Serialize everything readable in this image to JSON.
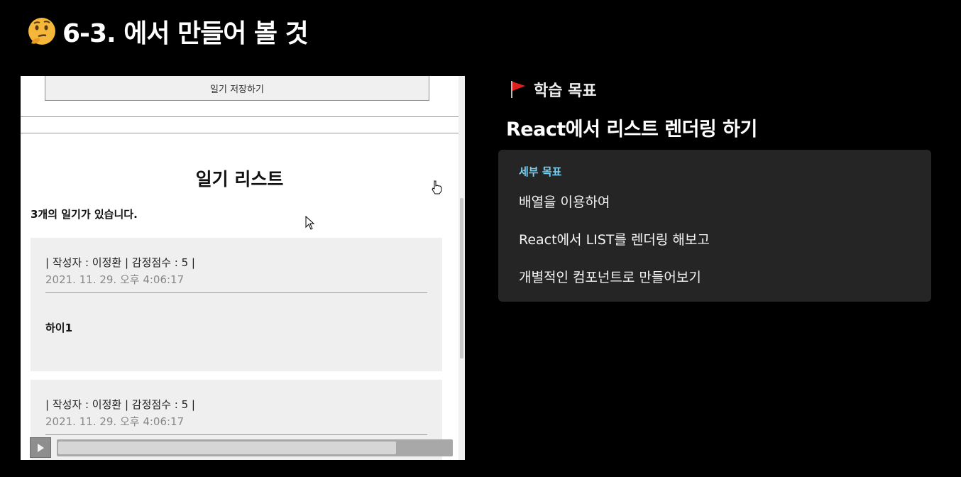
{
  "slide": {
    "title": "6-3. 에서 만들어 볼 것",
    "icon": "thinking-face-icon"
  },
  "demo": {
    "save_button_label": "일기 저장하기",
    "list_title": "일기 리스트",
    "count_text": "3개의 일기가 있습니다.",
    "items": [
      {
        "author": "| 작성자 : 이정환 | 감정점수 : 5 |",
        "date": "2021. 11. 29. 오후 4:06:17",
        "content": "하이1"
      },
      {
        "author": "| 작성자 : 이정환 | 감정점수 : 5 |",
        "date": "2021. 11. 29. 오후 4:06:17"
      }
    ],
    "playback_progress": 0.86
  },
  "goals": {
    "flag_icon": "red-flag-icon",
    "header": "학습 목표",
    "main": "React에서 리스트 렌더링 하기",
    "detail_label": "세부 목표",
    "details": [
      "배열을 이용하여",
      "React에서 LIST를 렌더링 해보고",
      "개별적인 컴포넌트로 만들어보기"
    ]
  },
  "colors": {
    "background": "#000000",
    "detail_box": "#252525",
    "detail_label": "#7ad0f0",
    "flag": "#e0201f"
  }
}
